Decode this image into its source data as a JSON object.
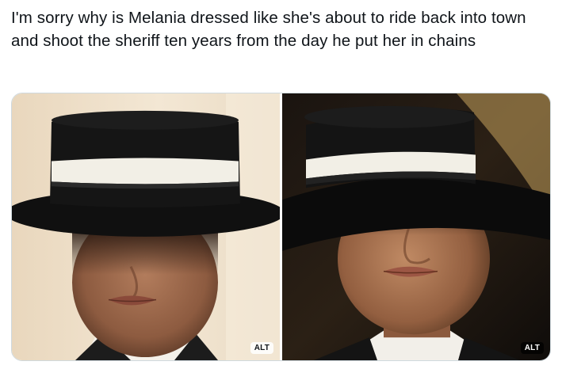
{
  "post": {
    "text": "I'm sorry why is Melania dressed like she's about to ride back into town and shoot the sheriff ten years from the day he put her in chains"
  },
  "media": {
    "photos": [
      {
        "alt_label": "ALT"
      },
      {
        "alt_label": "ALT"
      }
    ]
  },
  "colors": {
    "text": "#0f1419",
    "border": "#cfd9de",
    "hat": "#111111",
    "hat_band": "#f2efe6"
  }
}
